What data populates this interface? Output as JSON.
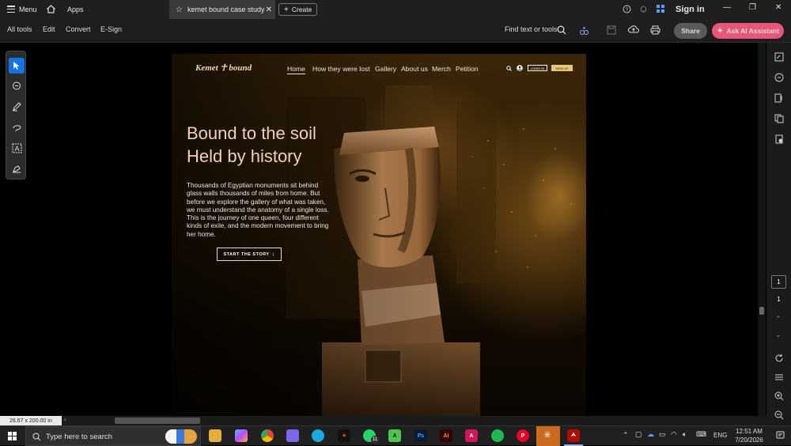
{
  "titlebar": {
    "menu_label": "Menu",
    "apps_label": "Apps",
    "tab_title": "kemet bound case study",
    "create_label": "Create",
    "signin_label": "Sign in"
  },
  "toolbar": {
    "all_tools": "All tools",
    "edit": "Edit",
    "convert": "Convert",
    "esign": "E-Sign",
    "find_placeholder": "Find text or tools",
    "share": "Share",
    "ask_ai": "Ask AI Assistant"
  },
  "document": {
    "logo": "Kemet ☥ bound",
    "nav": [
      "Home",
      "How they were lost",
      "Gallery",
      "About us",
      "Merch",
      "Petition"
    ],
    "login": "LOGIN IN",
    "signup": "SIGN UP",
    "hero_line1": "Bound to the soil",
    "hero_line2": "Held by history",
    "hero_paragraph": "Thousands of Egyptian monuments sit behind glass walls thousands of miles from home. But before we explore the gallery of what was taken, we must understand the anatomy of a single loss. This is the journey of one queen, four different kinds of exile, and the modern movement to bring her home.",
    "cta": "START THE STORY",
    "cta_arrow": "↓"
  },
  "rail": {
    "page_current": "1",
    "page_total": "1"
  },
  "status": {
    "page_size": "26.67 x 200.00 in"
  },
  "taskbar": {
    "search_placeholder": "Type here to search",
    "lang": "ENG",
    "time": "12:51 AM",
    "date": "7/20/2026",
    "whatsapp_badge": "11"
  },
  "colors": {
    "accent_ai": "#e8577a",
    "gold_text": "#f0d3b5",
    "selected_tool": "#1473e6"
  }
}
